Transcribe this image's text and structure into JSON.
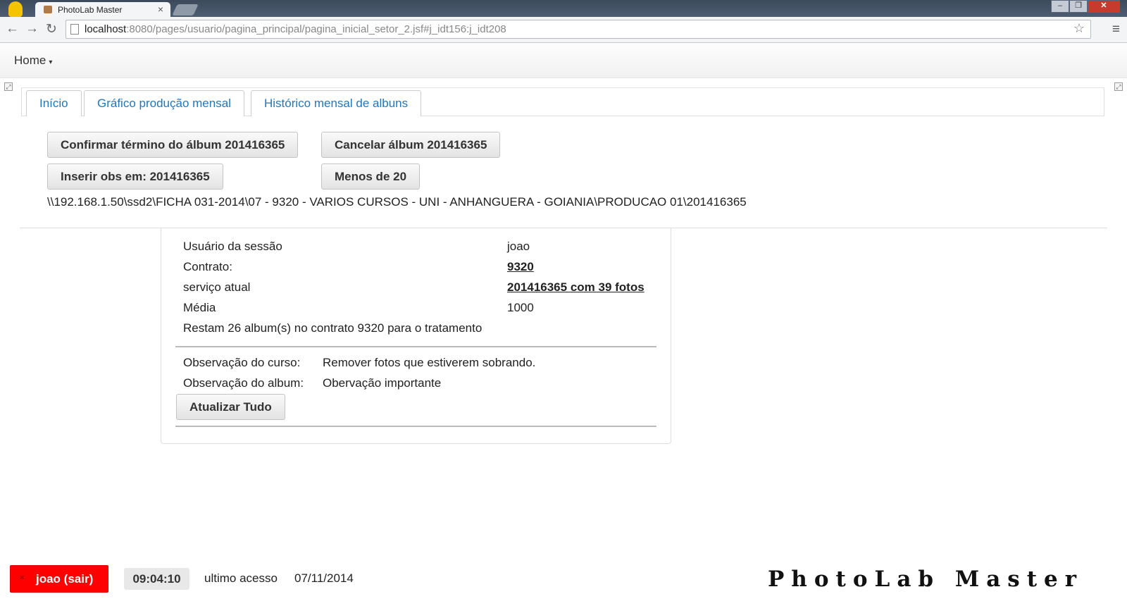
{
  "browser": {
    "tab_title": "PhotoLab Master",
    "tab_close": "×",
    "url_host": "localhost",
    "url_rest": ":8080/pages/usuario/pagina_principal/pagina_inicial_setor_2.jsf#j_idt156:j_idt208",
    "back": "←",
    "forward": "→",
    "reload": "↻",
    "star": "☆",
    "menu": "≡",
    "minimize": "‒",
    "maximize": "❐",
    "close": "✕"
  },
  "navbar": {
    "home": "Home",
    "caret": "▾"
  },
  "tabs": [
    {
      "label": "Início"
    },
    {
      "label": "Gráfico produção mensal"
    },
    {
      "label": "Histórico mensal de albuns"
    }
  ],
  "actions": {
    "confirm": "Confirmar término do álbum 201416365",
    "cancel": "Cancelar álbum 201416365",
    "insert_obs": "Inserir obs em: 201416365",
    "less_20": "Menos de 20"
  },
  "path": "\\\\192.168.1.50\\ssd2\\FICHA 031-2014\\07 - 9320 - VARIOS CURSOS - UNI - ANHANGUERA - GOIANIA\\PRODUCAO 01\\201416365",
  "info": {
    "session_user_label": "Usuário da sessão",
    "session_user_value": "joao",
    "contract_label": "Contrato:",
    "contract_value": "9320",
    "service_label": "serviço atual",
    "service_value": "201416365 com 39 fotos",
    "avg_label": "Média",
    "avg_value": "1000",
    "remaining": "Restam 26 album(s) no contrato 9320 para o tratamento",
    "course_obs_label": "Observação do curso:",
    "course_obs_value": "Remover fotos que estiverem sobrando.",
    "album_obs_label": "Observação do album:",
    "album_obs_value": "Obervação importante",
    "update_all": "Atualizar Tudo"
  },
  "footer": {
    "logout_x": "×",
    "logout_label": "joao (sair)",
    "clock": "09:04:10",
    "last_access_label": "ultimo acesso",
    "last_access_date": "07/11/2014",
    "brand": "PhotoLab Master"
  },
  "colors": {
    "tab_link": "#2277bb",
    "logout_bg": "#ff0000"
  },
  "icons": {
    "resize_left": "resize-icon",
    "resize_right": "resize-icon"
  }
}
